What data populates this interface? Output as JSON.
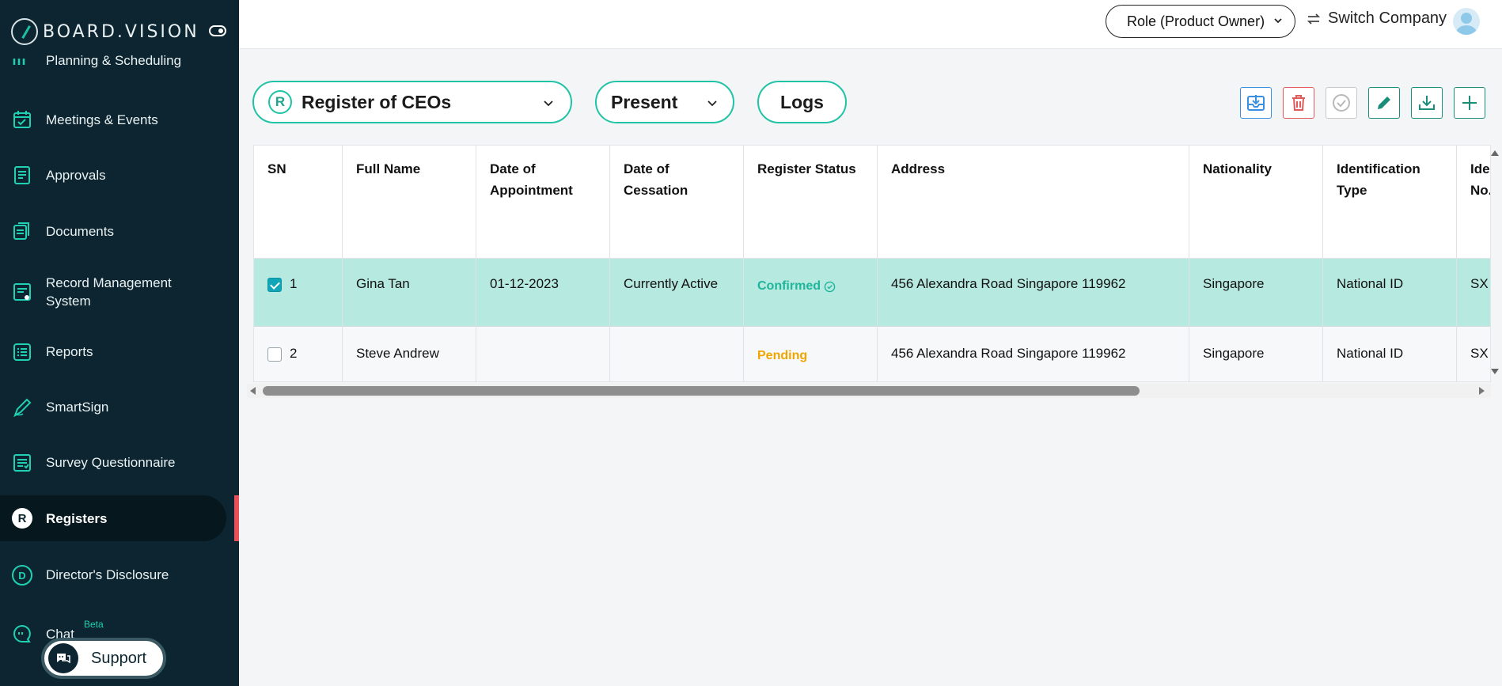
{
  "brand": {
    "name": "BOARD.VISION"
  },
  "sidebar": {
    "items": [
      {
        "label": "Planning & Scheduling",
        "icon": "calendar-dots-icon"
      },
      {
        "label": "Meetings & Events",
        "icon": "calendar-check-icon"
      },
      {
        "label": "Approvals",
        "icon": "document-lines-icon"
      },
      {
        "label": "Documents",
        "icon": "documents-stack-icon"
      },
      {
        "label": "Record Management System",
        "icon": "records-icon"
      },
      {
        "label": "Reports",
        "icon": "list-report-icon"
      },
      {
        "label": "SmartSign",
        "icon": "pen-sign-icon"
      },
      {
        "label": "Survey Questionnaire",
        "icon": "checklist-icon"
      },
      {
        "label": "Registers",
        "icon": "registers-r-icon",
        "active": true,
        "icon_letter": "R"
      },
      {
        "label": "Director's Disclosure",
        "icon": "disclosure-d-icon",
        "icon_letter": "D"
      },
      {
        "label": "Chat",
        "icon": "chat-bubble-icon",
        "badge": "Beta"
      }
    ],
    "support_label": "Support"
  },
  "header": {
    "role_label": "Role (Product Owner)",
    "switch_label": "Switch Company"
  },
  "toolbar": {
    "register_select": "Register of CEOs",
    "register_icon_letter": "R",
    "period_select": "Present",
    "logs_label": "Logs"
  },
  "table": {
    "columns": [
      "SN",
      "Full Name",
      "Date of Appointment",
      "Date of Cessation",
      "Register Status",
      "Address",
      "Nationality",
      "Identification Type",
      "Ide No."
    ],
    "rows": [
      {
        "sn": "1",
        "checked": true,
        "full_name": "Gina Tan",
        "date_of_appointment": "01-12-2023",
        "date_of_cessation": "Currently Active",
        "register_status": "Confirmed",
        "address": "456 Alexandra Road Singapore 119962",
        "nationality": "Singapore",
        "identification_type": "National ID",
        "identification_no": "SX"
      },
      {
        "sn": "2",
        "checked": false,
        "full_name": "Steve Andrew",
        "date_of_appointment": "",
        "date_of_cessation": "",
        "register_status": "Pending",
        "address": "456 Alexandra Road Singapore 119962",
        "nationality": "Singapore",
        "identification_type": "National ID",
        "identification_no": "SX"
      }
    ]
  },
  "colors": {
    "sidebar_bg": "#0c2530",
    "accent": "#20c3a5",
    "selected_row": "#b6e9e0",
    "confirmed": "#1fb59a",
    "pending": "#f0a500",
    "active_indicator": "#e9505a"
  }
}
